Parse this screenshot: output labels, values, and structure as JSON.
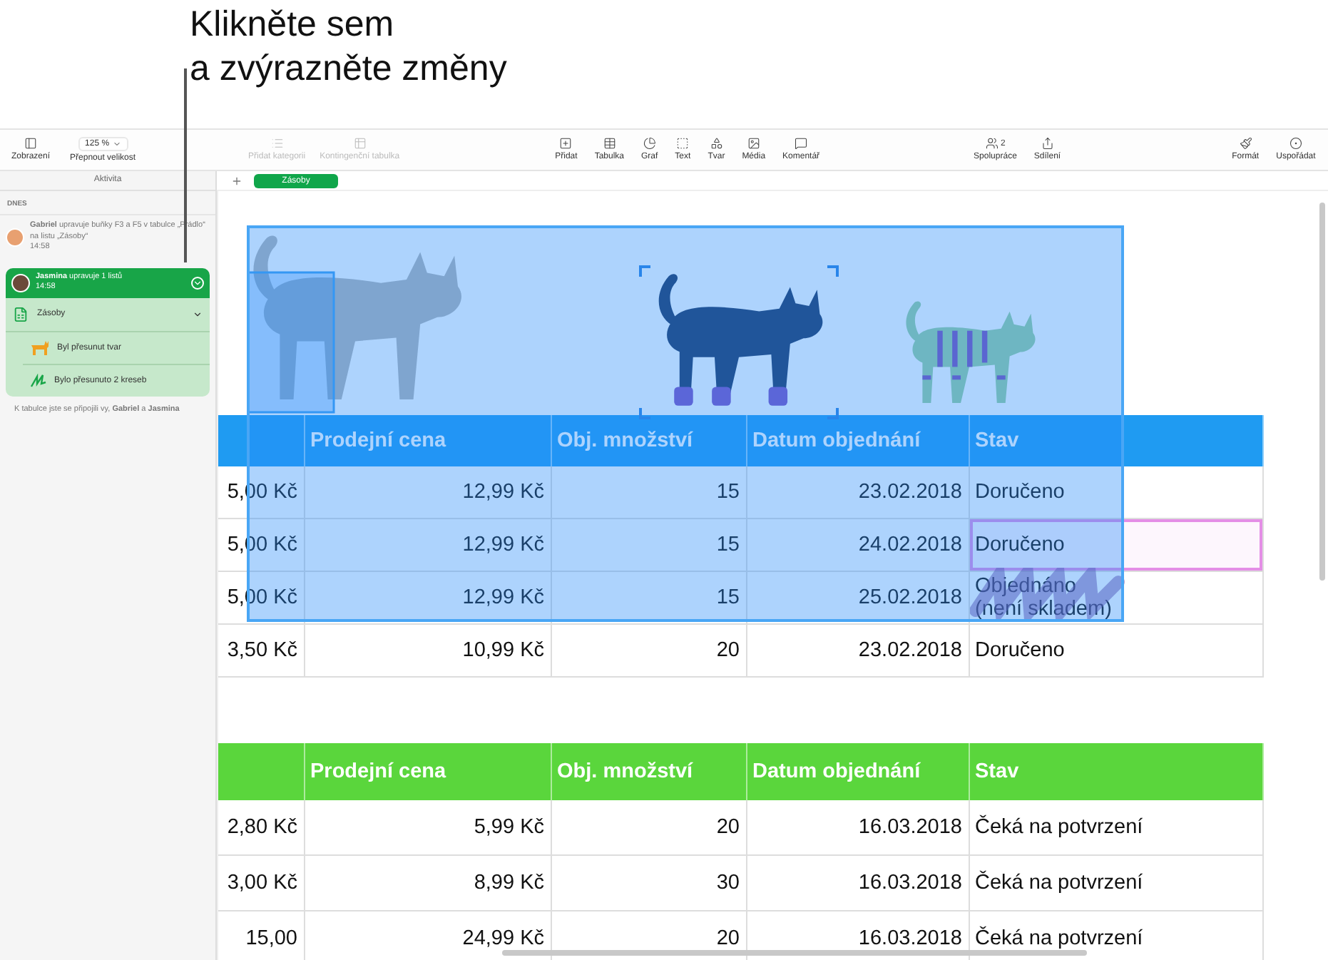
{
  "callout": {
    "lines": [
      "Klikněte sem",
      "a zvýrazněte změny"
    ]
  },
  "toolbar": {
    "view": {
      "label": "Zobrazení"
    },
    "zoom": {
      "value": "125 %",
      "label": "Přepnout velikost"
    },
    "left_items": [
      {
        "label": "Přidat kategorii",
        "disabled": true
      },
      {
        "label": "Kontingenční tabulka",
        "disabled": true
      }
    ],
    "insert_items": [
      {
        "label": "Přidat"
      },
      {
        "label": "Tabulka"
      },
      {
        "label": "Graf"
      },
      {
        "label": "Text"
      },
      {
        "label": "Tvar"
      },
      {
        "label": "Média"
      },
      {
        "label": "Komentář"
      }
    ],
    "collab": {
      "label": "Spolupráce",
      "count": "2"
    },
    "share": {
      "label": "Sdílení"
    },
    "right_items": [
      {
        "label": "Formát"
      },
      {
        "label": "Uspořádat"
      }
    ]
  },
  "sidebar": {
    "title": "Aktivita",
    "section": "DNES",
    "entries": [
      {
        "author": "Gabriel",
        "text": "upravuje buňky F3 a F5 v tabulce „Prádlo“ na listu „Zásoby“",
        "time": "14:58",
        "expanded": false
      },
      {
        "author": "Jasmina",
        "text": "upravuje 1 listů",
        "time": "14:58",
        "expanded": true,
        "sheet": "Zásoby",
        "changes": [
          {
            "kind": "shape",
            "text": "Byl přesunut tvar"
          },
          {
            "kind": "drawing",
            "text": "Bylo přesunuto 2 kreseb"
          }
        ]
      }
    ],
    "footer": "K tabulce jste se připojili vy, **Gabriel** a **Jasmina**"
  },
  "sheet_tabs": [
    {
      "label": "Zásoby",
      "selected": true
    }
  ],
  "tables": [
    {
      "color": "#1f9bf2",
      "columns": [
        "",
        "Prodejní cena",
        "Obj. množství",
        "Datum objednání",
        "Stav"
      ],
      "rows": [
        {
          "cells": [
            "5,00 Kč",
            "12,99 Kč",
            "15",
            "23.02.2018",
            "Doručeno"
          ],
          "highlighted": false
        },
        {
          "cells": [
            "5,00 Kč",
            "12,99 Kč",
            "15",
            "24.02.2018",
            "Doručeno"
          ],
          "highlighted": true
        },
        {
          "cells": [
            "5,00 Kč",
            "12,99 Kč",
            "15",
            "25.02.2018",
            "Objednáno\n(není skladem)"
          ],
          "highlighted": false
        },
        {
          "cells": [
            "3,50 Kč",
            "10,99 Kč",
            "20",
            "23.02.2018",
            "Doručeno"
          ],
          "highlighted": false
        }
      ]
    },
    {
      "color": "#5ad63c",
      "columns": [
        "",
        "Prodejní cena",
        "Obj. množství",
        "Datum objednání",
        "Stav"
      ],
      "rows": [
        {
          "cells": [
            "2,80 Kč",
            "5,99 Kč",
            "20",
            "16.03.2018",
            "Čeká na potvrzení"
          ],
          "highlighted": false
        },
        {
          "cells": [
            "3,00 Kč",
            "8,99 Kč",
            "30",
            "16.03.2018",
            "Čeká na potvrzení"
          ],
          "highlighted": false
        },
        {
          "cells": [
            "15,00",
            "24,99 Kč",
            "20",
            "16.03.2018",
            "Čeká na potvrzení"
          ],
          "highlighted": false
        }
      ]
    }
  ]
}
